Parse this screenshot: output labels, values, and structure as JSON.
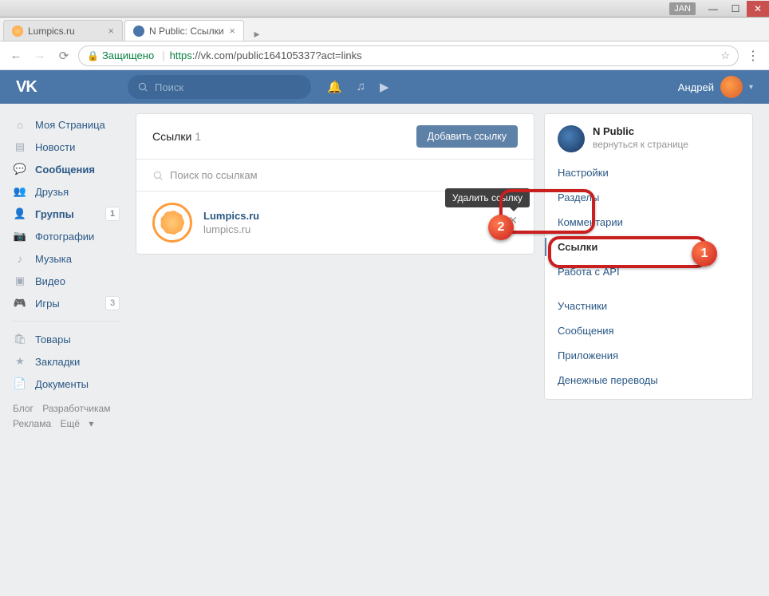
{
  "window": {
    "ext_label": "JAN"
  },
  "browser": {
    "tabs": [
      {
        "title": "Lumpics.ru"
      },
      {
        "title": "N Public: Ссылки"
      }
    ],
    "secure_label": "Защищено",
    "url_proto": "https",
    "url_rest": "://vk.com/public164105337?act=links"
  },
  "header": {
    "search_placeholder": "Поиск",
    "user_name": "Андрей"
  },
  "sidebar": {
    "items": [
      {
        "label": "Моя Страница",
        "icon": "home"
      },
      {
        "label": "Новости",
        "icon": "news"
      },
      {
        "label": "Сообщения",
        "icon": "msg",
        "bold": true
      },
      {
        "label": "Друзья",
        "icon": "friends"
      },
      {
        "label": "Группы",
        "icon": "groups",
        "badge": "1",
        "bold": true
      },
      {
        "label": "Фотографии",
        "icon": "photo"
      },
      {
        "label": "Музыка",
        "icon": "music"
      },
      {
        "label": "Видео",
        "icon": "video"
      },
      {
        "label": "Игры",
        "icon": "games",
        "badge": "3"
      }
    ],
    "items2": [
      {
        "label": "Товары",
        "icon": "market"
      },
      {
        "label": "Закладки",
        "icon": "fav"
      },
      {
        "label": "Документы",
        "icon": "doc"
      }
    ]
  },
  "footer": {
    "blog": "Блог",
    "dev": "Разработчикам",
    "ads": "Реклама",
    "more": "Ещё"
  },
  "content": {
    "title": "Ссылки",
    "count": "1",
    "add_btn": "Добавить ссылку",
    "search_placeholder": "Поиск по ссылкам",
    "link": {
      "title": "Lumpics.ru",
      "subtitle": "lumpics.ru"
    },
    "tooltip": "Удалить ссылку"
  },
  "manage": {
    "name": "N Public",
    "back": "вернуться к странице",
    "items": [
      "Настройки",
      "Разделы",
      "Комментарии",
      "Ссылки",
      "Работа с API",
      "Участники",
      "Сообщения",
      "Приложения",
      "Денежные переводы"
    ],
    "active_index": 3
  },
  "annotations": {
    "one": "1",
    "two": "2"
  }
}
